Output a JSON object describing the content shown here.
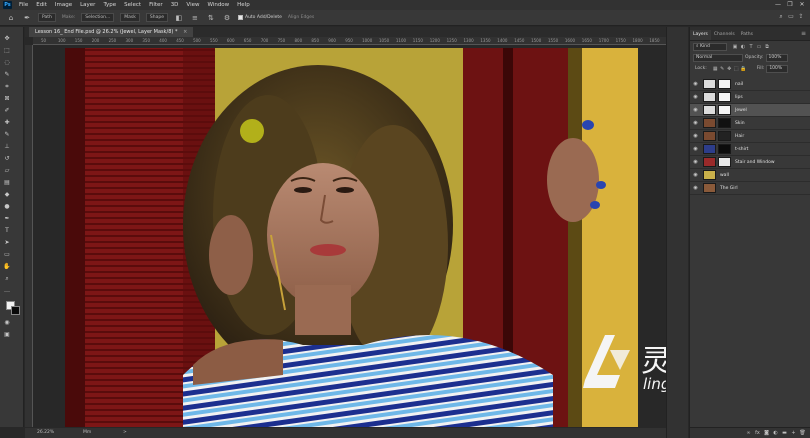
{
  "app": {
    "logo": "Ps",
    "menu": [
      "File",
      "Edit",
      "Image",
      "Layer",
      "Type",
      "Select",
      "Filter",
      "3D",
      "View",
      "Window",
      "Help"
    ],
    "window_controls": [
      "—",
      "❐",
      "✕"
    ]
  },
  "options_bar": {
    "mode_value": "Path",
    "make_label": "Make:",
    "selection_button": "Selection...",
    "mask_button": "Mask",
    "shape_button": "Shape",
    "auto_add_delete_label": "Auto Add/Delete",
    "auto_add_delete_checked": true,
    "align_edges_label": "Align Edges"
  },
  "document": {
    "tab_title": "Lesson 16_ End File.psd @ 26.2% (Jewel, Layer Mask/8) *",
    "ruler_ticks": [
      "50",
      "100",
      "150",
      "200",
      "250",
      "300",
      "350",
      "400",
      "450",
      "500",
      "550",
      "600",
      "650",
      "700",
      "750",
      "800",
      "850",
      "900",
      "950",
      "1000",
      "1050",
      "1100",
      "1150",
      "1200",
      "1250",
      "1300",
      "1350",
      "1400",
      "1450",
      "1500",
      "1550",
      "1600",
      "1650",
      "1700",
      "1750",
      "1800",
      "1850"
    ],
    "status_zoom": "26.22%",
    "status_info": "Mm",
    "status_arrow": ">"
  },
  "layers_panel": {
    "tabs": [
      "Layers",
      "Channels",
      "Paths"
    ],
    "active_tab": "Layers",
    "filter_kind": "Kind",
    "blend_mode": "Normal",
    "opacity_label": "Opacity:",
    "opacity_value": "100%",
    "lock_label": "Lock:",
    "fill_label": "Fill:",
    "fill_value": "100%",
    "layers": [
      {
        "name": "nail",
        "thumb_color": "#dcdcdc",
        "mask_color": "#f4f4f4",
        "selected": false
      },
      {
        "name": "lips",
        "thumb_color": "#dcdcdc",
        "mask_color": "#f4f4f4",
        "selected": false
      },
      {
        "name": "Jewel",
        "thumb_color": "#dcdcdc",
        "mask_color": "#f4f4f4",
        "selected": true
      },
      {
        "name": "Skin",
        "thumb_color": "#7a4a30",
        "mask_color": "#111111",
        "selected": false
      },
      {
        "name": "Hair",
        "thumb_color": "#7a4a30",
        "mask_color": "#222222",
        "selected": false
      },
      {
        "name": "t-shirt",
        "thumb_color": "#2d3d8a",
        "mask_color": "#0c0c0c",
        "selected": false
      },
      {
        "name": "Stair and Window",
        "thumb_color": "#9a2a2a",
        "mask_color": "#e8e8e8",
        "selected": false
      },
      {
        "name": "wall",
        "thumb_color": "#c9b04a",
        "mask_color": "",
        "selected": false
      },
      {
        "name": "The Girl",
        "thumb_color": "#8a5a3a",
        "mask_color": "",
        "selected": false
      }
    ],
    "bottom_icons": [
      "link-icon",
      "fx-icon",
      "mask-icon",
      "adjustment-icon",
      "group-icon",
      "new-layer-icon",
      "trash-icon"
    ]
  },
  "watermark": {
    "chinese": "灵感中国",
    "latin": "lingganchina.com"
  }
}
